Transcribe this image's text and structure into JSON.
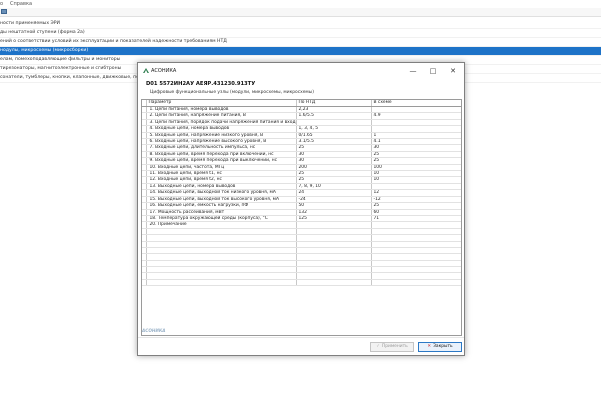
{
  "background": {
    "menu": [
      "о",
      "Справка"
    ],
    "list_items": [
      "ности применяемых ЭРИ",
      "ды нештатной ступени (форма 2а)",
      "ений о соответствии условий их эксплуатации и показателей надежности требованиям НТД",
      "нодулы, микросхемы (микросборки)",
      "елам, помехоподавляющие фильтры и мониторы",
      "тирезонаторы, магнитоэлектронные и сгибтроны",
      "сонатели, тумблеры, кнопки, клапонные, движковые, поворотные"
    ],
    "selected_index": 3
  },
  "dialog": {
    "window_title": "АСОНИКА",
    "device_title": "D01 5572ИН2АУ АЕЯР.431230.913ТУ",
    "subtitle": "Цифровые функциональные узлы (модули, микросхемы, микросхемы)",
    "columns": [
      "",
      "Параметр",
      "По НТД",
      "В схеме"
    ],
    "rows": [
      [
        "1. Цепи питания, номера выводов",
        "2,23",
        ""
      ],
      [
        "2. Цепи питания, напряжение питания, В",
        "1.6/5.5",
        "4.9"
      ],
      [
        "3. Цепи питания, порядок подачи напряжения питания и входных сигнал",
        "",
        ""
      ],
      [
        "4. Входные цепи, номера выводов",
        "1, 3, 4, 5",
        ""
      ],
      [
        "5. Входные цепи, напряжение низкого уровня, В",
        "0/1.65",
        "1"
      ],
      [
        "6. Входные цепи, напряжение высокого уровня, В",
        "3.1/5.5",
        "4.1"
      ],
      [
        "7. Входные цепи, длительность импульса, нс",
        "25",
        "30"
      ],
      [
        "8. Входные цепи, время перехода при включении, нс",
        "30",
        "25"
      ],
      [
        "9. Входные цепи, время перехода при выключении, нс",
        "30",
        "25"
      ],
      [
        "10. Входные цепи, частота, МГц",
        "200",
        "100"
      ],
      [
        "11. Входные цепи, время t1, нс",
        "25",
        "10"
      ],
      [
        "12. Входные цепи, время t2, нс",
        "25",
        "10"
      ],
      [
        "13. Выходные цепи, номера выводов",
        "7, 8, 9, 10",
        ""
      ],
      [
        "14. Выходные цепи, выходной ток низкого уровня, мА",
        "24",
        "12"
      ],
      [
        "15. Выходные цепи, выходной ток высокого уровня, мА",
        "-24",
        "-12"
      ],
      [
        "16. Выходные цепи, емкость нагрузки, пФ",
        "50",
        "25"
      ],
      [
        "17. Мощность рассеивания, мВт",
        "132",
        "60"
      ],
      [
        "18. Температура окружающей среды (корпуса), °С",
        "125",
        "71"
      ],
      [
        "20. Примечание",
        "",
        ""
      ]
    ],
    "brand": "АСОНИКА",
    "apply_label": "Применить",
    "close_label": "Закрыть"
  },
  "colors": {
    "selection": "#1e73c8",
    "close_button_border": "#2b78c5",
    "close_icon": "#c62828"
  }
}
